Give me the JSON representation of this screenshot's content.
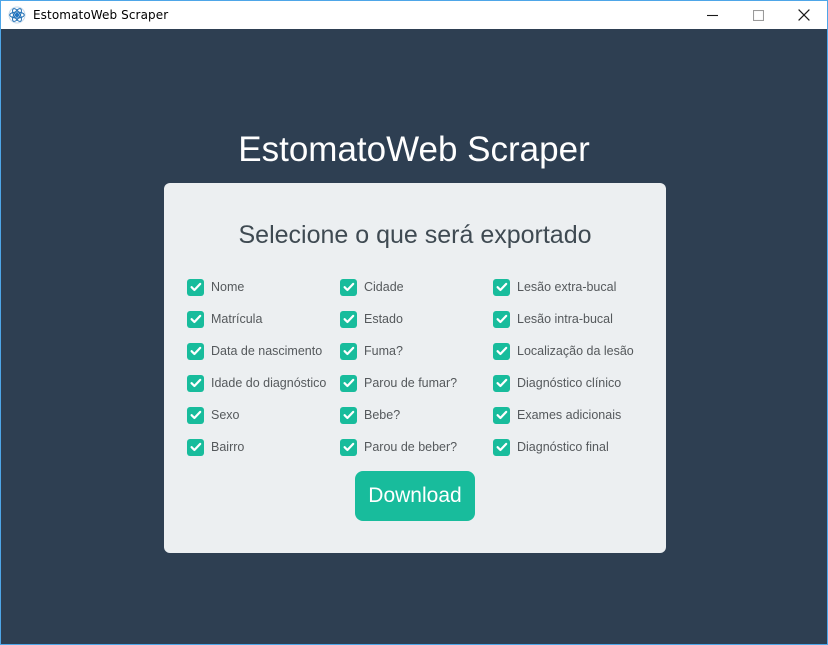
{
  "window": {
    "title": "EstomatoWeb Scraper",
    "icon": "app-atom-icon",
    "border_color": "#4ea6e8",
    "background_color": "#2e3f52",
    "controls": {
      "minimize": "minimize-icon",
      "maximize": "maximize-icon",
      "close": "close-icon"
    }
  },
  "main": {
    "app_title": "EstomatoWeb Scraper",
    "card": {
      "heading": "Selecione o que será exportado",
      "background_color": "#eceff1",
      "accent_color": "#18bc9c",
      "columns": [
        {
          "items": [
            {
              "label": "Nome",
              "checked": true
            },
            {
              "label": "Matrícula",
              "checked": true
            },
            {
              "label": "Data de nascimento",
              "checked": true
            },
            {
              "label": "Idade do diagnóstico",
              "checked": true
            },
            {
              "label": "Sexo",
              "checked": true
            },
            {
              "label": "Bairro",
              "checked": true
            }
          ]
        },
        {
          "items": [
            {
              "label": "Cidade",
              "checked": true
            },
            {
              "label": "Estado",
              "checked": true
            },
            {
              "label": "Fuma?",
              "checked": true
            },
            {
              "label": "Parou de fumar?",
              "checked": true
            },
            {
              "label": "Bebe?",
              "checked": true
            },
            {
              "label": "Parou de beber?",
              "checked": true
            }
          ]
        },
        {
          "items": [
            {
              "label": "Lesão extra-bucal",
              "checked": true
            },
            {
              "label": "Lesão intra-bucal",
              "checked": true
            },
            {
              "label": "Localização da lesão",
              "checked": true
            },
            {
              "label": "Diagnóstico clínico",
              "checked": true
            },
            {
              "label": "Exames adicionais",
              "checked": true
            },
            {
              "label": "Diagnóstico final",
              "checked": true
            }
          ]
        }
      ],
      "download_label": "Download"
    }
  }
}
